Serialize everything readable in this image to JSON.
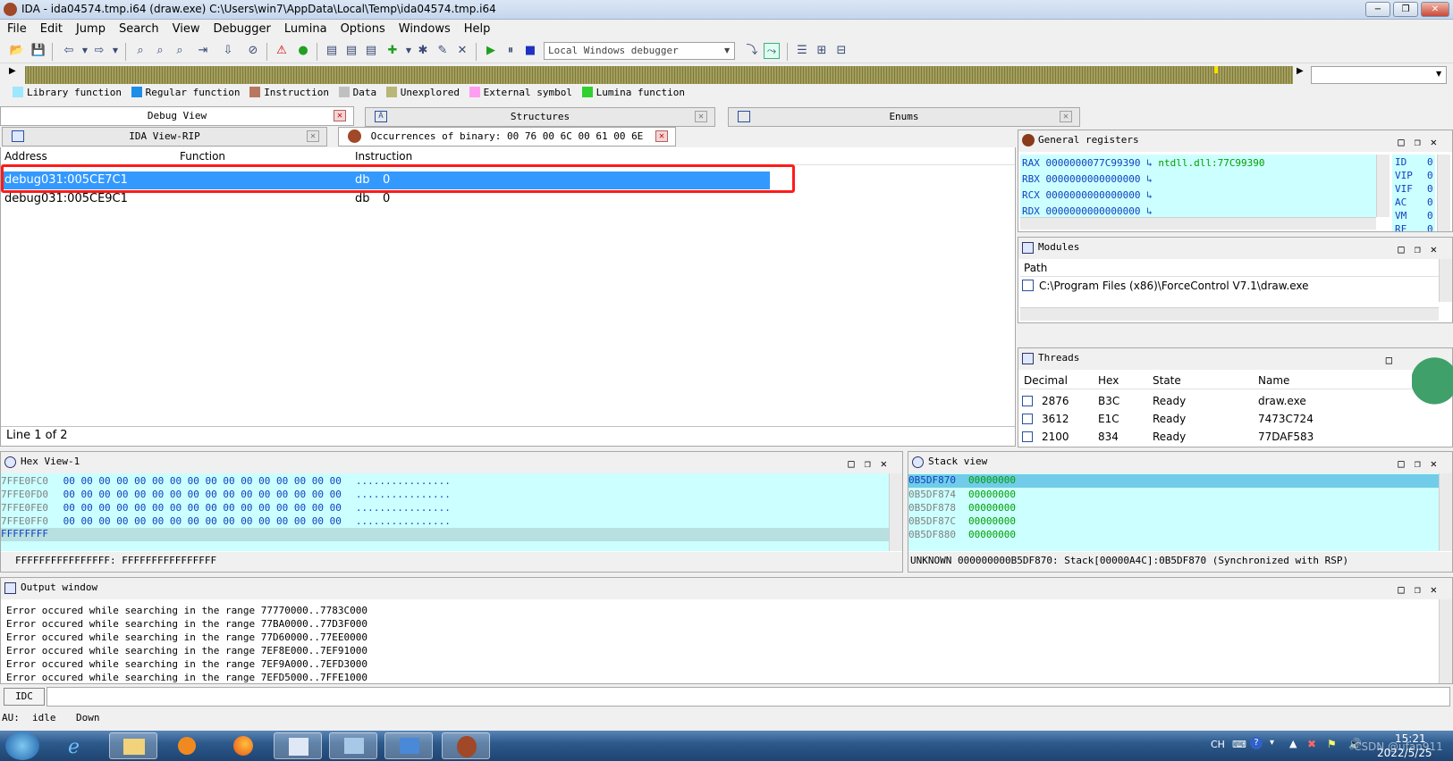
{
  "window": {
    "title": "IDA - ida04574.tmp.i64 (draw.exe) C:\\Users\\win7\\AppData\\Local\\Temp\\ida04574.tmp.i64",
    "minimize": "−",
    "maximize": "❐",
    "close": "✕"
  },
  "menu": [
    "File",
    "Edit",
    "Jump",
    "Search",
    "View",
    "Debugger",
    "Lumina",
    "Options",
    "Windows",
    "Help"
  ],
  "toolbar": {
    "debugger_select": "Local Windows debugger"
  },
  "legend": [
    {
      "label": "Library function",
      "color": "#9ee8ff"
    },
    {
      "label": "Regular function",
      "color": "#1c8ee8"
    },
    {
      "label": "Instruction",
      "color": "#b87860"
    },
    {
      "label": "Data",
      "color": "#c0c0c0"
    },
    {
      "label": "Unexplored",
      "color": "#b8b678"
    },
    {
      "label": "External symbol",
      "color": "#ff9ef0"
    },
    {
      "label": "Lumina function",
      "color": "#30d030"
    }
  ],
  "tabs_top": [
    {
      "label": "Debug View"
    },
    {
      "label": "Structures",
      "icon": "A"
    },
    {
      "label": "Enums"
    }
  ],
  "tabs_second": [
    {
      "label": "IDA View-RIP"
    },
    {
      "label": "Occurrences of binary: 00 76 00 6C 00 61 00 6E"
    }
  ],
  "occurrences": {
    "columns": [
      "Address",
      "Function",
      "Instruction"
    ],
    "rows": [
      {
        "address": "debug031:005CE7C1",
        "function": "",
        "instr": "db",
        "operand": "0"
      },
      {
        "address": "debug031:005CE9C1",
        "function": "",
        "instr": "db",
        "operand": "0"
      }
    ],
    "status": "Line 1 of 2"
  },
  "registers": {
    "title": "General registers",
    "rows": [
      {
        "name": "RAX",
        "value": "0000000077C99390",
        "ref": "ntdll.dll:77C99390"
      },
      {
        "name": "RBX",
        "value": "0000000000000000",
        "ref": ""
      },
      {
        "name": "RCX",
        "value": "0000000000000000",
        "ref": ""
      },
      {
        "name": "RDX",
        "value": "0000000000000000",
        "ref": ""
      }
    ],
    "flags": [
      {
        "name": "ID",
        "value": "0"
      },
      {
        "name": "VIP",
        "value": "0"
      },
      {
        "name": "VIF",
        "value": "0"
      },
      {
        "name": "AC",
        "value": "0"
      },
      {
        "name": "VM",
        "value": "0"
      },
      {
        "name": "RF",
        "value": "0"
      }
    ]
  },
  "modules": {
    "title": "Modules",
    "column": "Path",
    "rows": [
      "C:\\Program Files (x86)\\ForceControl V7.1\\draw.exe"
    ]
  },
  "threads": {
    "title": "Threads",
    "columns": [
      "Decimal",
      "Hex",
      "State",
      "Name"
    ],
    "rows": [
      {
        "dec": "2876",
        "hex": "B3C",
        "state": "Ready",
        "name": "draw.exe"
      },
      {
        "dec": "3612",
        "hex": "E1C",
        "state": "Ready",
        "name": "7473C724"
      },
      {
        "dec": "2100",
        "hex": "834",
        "state": "Ready",
        "name": "77DAF583"
      }
    ]
  },
  "hexview": {
    "title": "Hex View-1",
    "rows": [
      {
        "addr": "7FFE0FC0",
        "bytes": "00 00 00 00 00 00 00 00  00 00 00 00 00 00 00 00",
        "ascii": "................"
      },
      {
        "addr": "7FFE0FD0",
        "bytes": "00 00 00 00 00 00 00 00  00 00 00 00 00 00 00 00",
        "ascii": "................"
      },
      {
        "addr": "7FFE0FE0",
        "bytes": "00 00 00 00 00 00 00 00  00 00 00 00 00 00 00 00",
        "ascii": "................"
      },
      {
        "addr": "7FFE0FF0",
        "bytes": "00 00 00 00 00 00 00 00  00 00 00 00 00 00 00 00",
        "ascii": "................"
      }
    ],
    "last_addr": "FFFFFFFF",
    "status": "FFFFFFFFFFFFFFFF: FFFFFFFFFFFFFFFF"
  },
  "stackview": {
    "title": "Stack view",
    "rows": [
      {
        "addr": "0B5DF870",
        "val": "00000000"
      },
      {
        "addr": "0B5DF874",
        "val": "00000000"
      },
      {
        "addr": "0B5DF878",
        "val": "00000000"
      },
      {
        "addr": "0B5DF87C",
        "val": "00000000"
      },
      {
        "addr": "0B5DF880",
        "val": "00000000"
      }
    ],
    "status_a": "UNKNOWN",
    "status_b": "000000000B5DF870: Stack[00000A4C]:0B5DF870 (Synchronized with RSP)"
  },
  "output": {
    "title": "Output window",
    "lines": [
      "Error occured while searching in the range 77770000..7783C000",
      "Error occured while searching in the range 77BA0000..77D3F000",
      "Error occured while searching in the range 77D60000..77EE0000",
      "Error occured while searching in the range 7EF8E000..7EF91000",
      "Error occured while searching in the range 7EF9A000..7EFD3000",
      "Error occured while searching in the range 7EFD5000..7FFE1000"
    ],
    "idc_label": "IDC"
  },
  "statusbar": {
    "au_label": "AU:",
    "au_state": "idle",
    "direction": "Down"
  },
  "taskbar": {
    "lang": "CH",
    "time": "15:21",
    "date": "2022/5/25",
    "watermark": "CSDN @ufan911"
  }
}
